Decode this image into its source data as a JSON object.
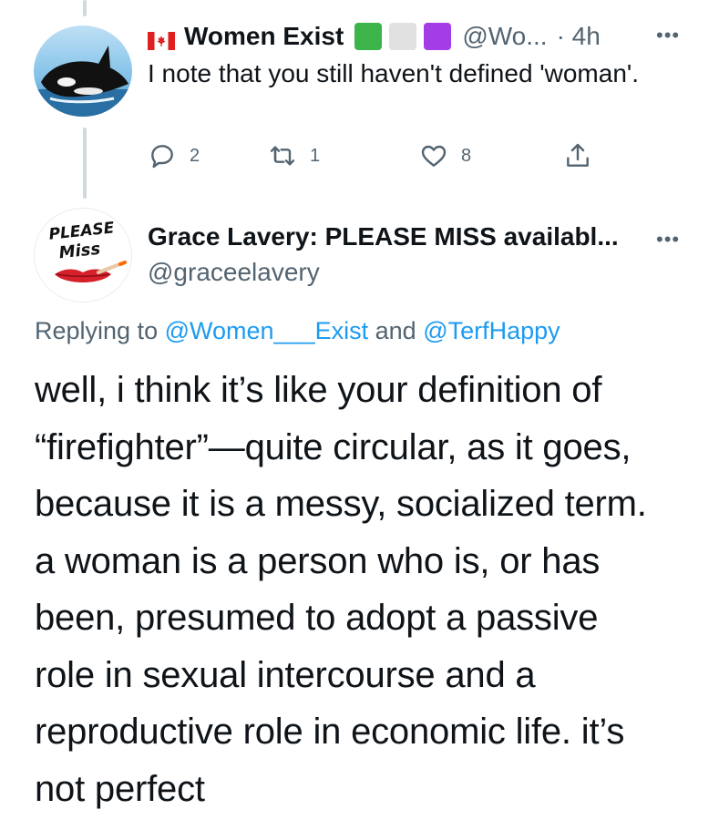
{
  "tweet1": {
    "display_name": "Women Exist",
    "handle": "@Wo...",
    "time": "· 4h",
    "body": "I note that you still haven't defined 'woman'.",
    "name_emojis": [
      "flag-canada-icon",
      "green-square-icon",
      "white-square-icon",
      "purple-square-icon"
    ],
    "stats": {
      "replies": "2",
      "retweets": "1",
      "likes": "8"
    }
  },
  "tweet2": {
    "avatar_text_line1": "PLEASE",
    "avatar_text_line2": "Miss",
    "display_name": "Grace Lavery: PLEASE MISS availabl...",
    "handle": "@graceelavery",
    "replying_prefix": "Replying to",
    "replying_user1": "@Women___Exist",
    "replying_and": "and",
    "replying_user2": "@TerfHappy",
    "body_lines": [
      "well, i think it’s like your definition of",
      "“firefighter”—quite circular, as it goes,",
      "because it is a messy, socialized term.",
      "a woman is a person who is, or has",
      "been, presumed to adopt a passive",
      "role in sexual intercourse and a",
      "reproductive role in economic life. it’s",
      "not perfect"
    ]
  },
  "colors": {
    "text": "#0f1419",
    "secondary": "#536471",
    "link": "#1d9bf0",
    "thread_line": "#cfd9de",
    "green_square": "#3cb44a",
    "white_square": "#e1e1e1",
    "purple_square": "#a33ee6"
  }
}
